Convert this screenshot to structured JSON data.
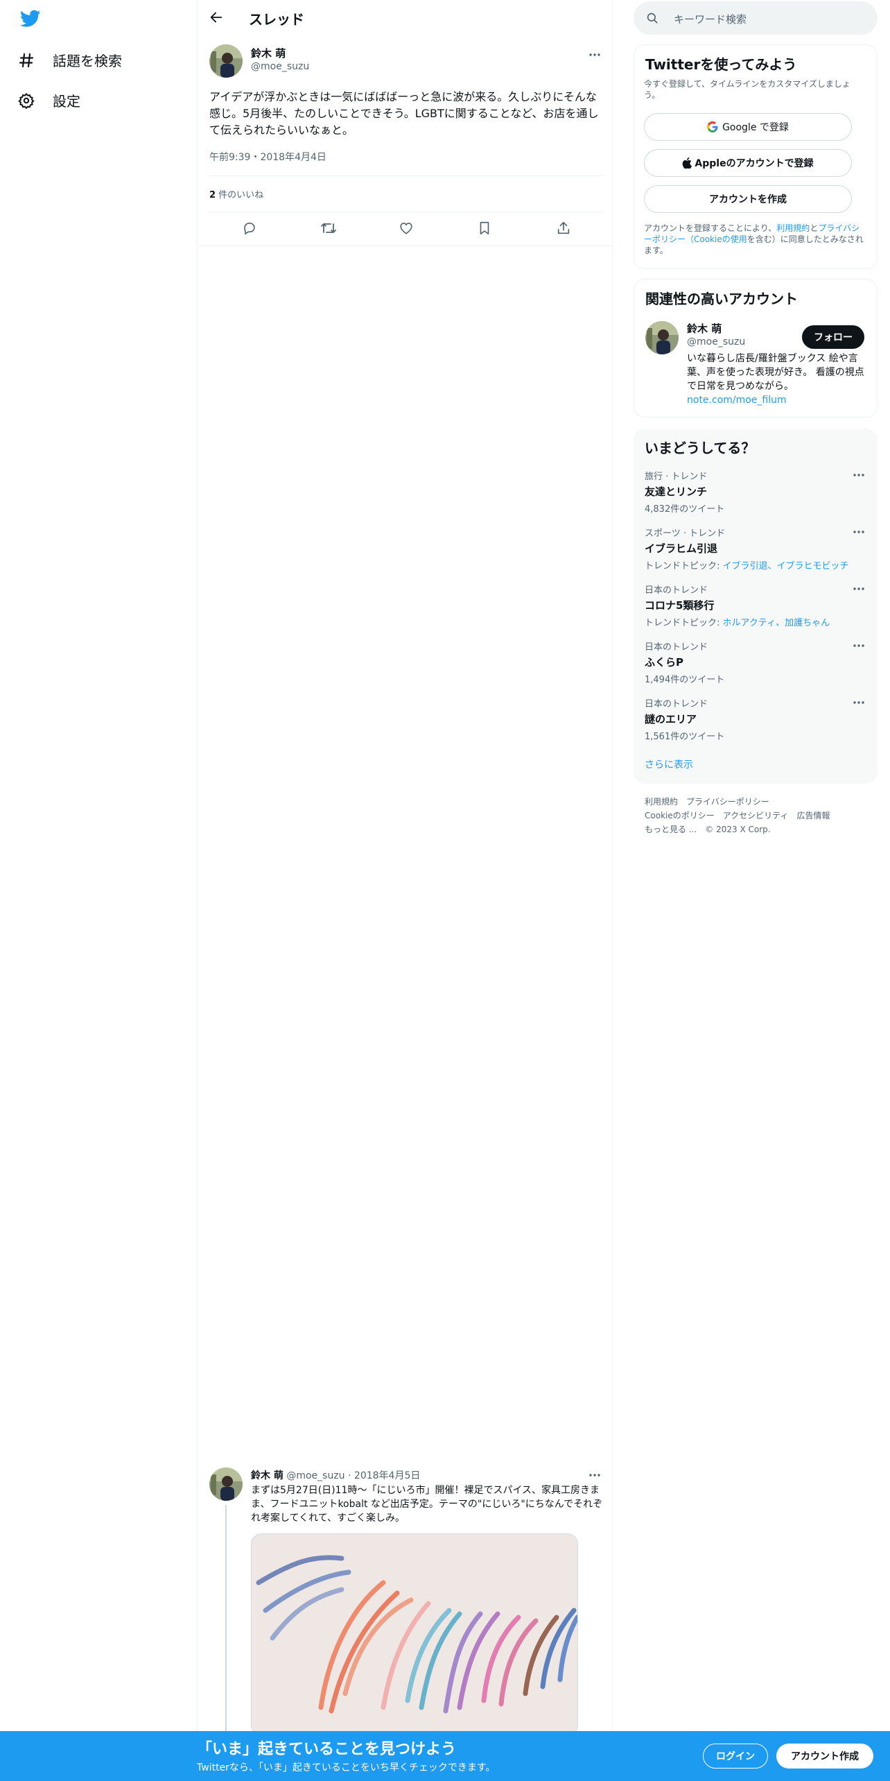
{
  "colors": {
    "brand": "#1d9bf0",
    "text": "#0f1419",
    "muted": "#536471",
    "border": "#eff3f4"
  },
  "nav": {
    "logo_icon": "twitter-bird-icon",
    "items": [
      {
        "icon": "hashtag-icon",
        "label": "話題を検索"
      },
      {
        "icon": "gear-icon",
        "label": "設定"
      }
    ]
  },
  "header": {
    "title": "スレッド",
    "back_icon": "back-arrow-icon"
  },
  "tweet": {
    "author_name": "鈴木 萌",
    "author_handle": "@moe_suzu",
    "text": "アイデアが浮かぶときは一気にばばばーっと急に波が来る。久しぶりにそんな感じ。5月後半、たのしいことできそう。LGBTに関することなど、お店を通して伝えられたらいいなぁと。",
    "timestamp": "午前9:39・2018年4月4日",
    "likes_count": "2",
    "likes_label": " 件のいいね",
    "actions": [
      "reply-icon",
      "retweet-icon",
      "like-icon",
      "bookmark-icon",
      "share-icon"
    ]
  },
  "reply": {
    "author_name": "鈴木 萌",
    "author_handle": "@moe_suzu",
    "dot": "·",
    "date": "2018年4月5日",
    "text": "まずは5月27日(日)11時〜「にじいろ市」開催！裸足でスパイス、家具工房きまま、フードユニットkobalt など出店予定。テーマの\"にじいろ\"にちなんでそれぞれ考案してくれて、すごく楽しみ。"
  },
  "search": {
    "placeholder": "キーワード検索"
  },
  "signup": {
    "title": "Twitterを使ってみよう",
    "subtitle": "今すぐ登録して、タイムラインをカスタマイズしましょう。",
    "google_label": "Google で登録",
    "apple_label": "Appleのアカウントで登録",
    "create_label": "アカウントを作成",
    "terms_prefix": "アカウントを登録することにより、",
    "terms_link": "利用規約",
    "terms_and": "と",
    "privacy_link": "プライバシーポリシー",
    "cookie_link": "（Cookieの使用",
    "terms_suffix": "を含む）に同意したとみなされます。"
  },
  "related": {
    "title": "関連性の高いアカウント",
    "name": "鈴木 萌",
    "handle": "@moe_suzu",
    "follow_label": "フォロー",
    "bio": "いな暮らし店長/羅針盤ブックス 絵や言葉、声を使った表現が好き。 看護の視点で日常を見つめながら。",
    "bio_link": "note.com/moe_filum"
  },
  "trends": {
    "title": "いまどうしてる？",
    "items": [
      {
        "category": "旅行 · トレンド",
        "name": "友達とリンチ",
        "sub": "4,832件のツイート",
        "topics": ""
      },
      {
        "category": "スポーツ · トレンド",
        "name": "イブラヒム引退",
        "sub": "トレンドトピック: ",
        "topics": "イブラ引退、イブラヒモビッチ"
      },
      {
        "category": "日本のトレンド",
        "name": "コロナ5類移行",
        "sub": "トレンドトピック: ",
        "topics": "ホルアクティ、加護ちゃん"
      },
      {
        "category": "日本のトレンド",
        "name": "ふくらP",
        "sub": "1,494件のツイート",
        "topics": ""
      },
      {
        "category": "日本のトレンド",
        "name": "謎のエリア",
        "sub": "1,561件のツイート",
        "topics": ""
      }
    ],
    "more_label": "さらに表示"
  },
  "footer": {
    "terms": "利用規約",
    "privacy": "プライバシーポリシー",
    "cookie": "Cookieのポリシー",
    "accessibility": "アクセシビリティ",
    "ads": "広告情報",
    "more": "もっと見る ...",
    "copyright": "© 2023 X Corp."
  },
  "bottom": {
    "headline": "「いま」起きていることを見つけよう",
    "sub": "Twitterなら、「いま」起きていることをいち早くチェックできます。",
    "login_label": "ログイン",
    "signup_label": "アカウント作成"
  }
}
